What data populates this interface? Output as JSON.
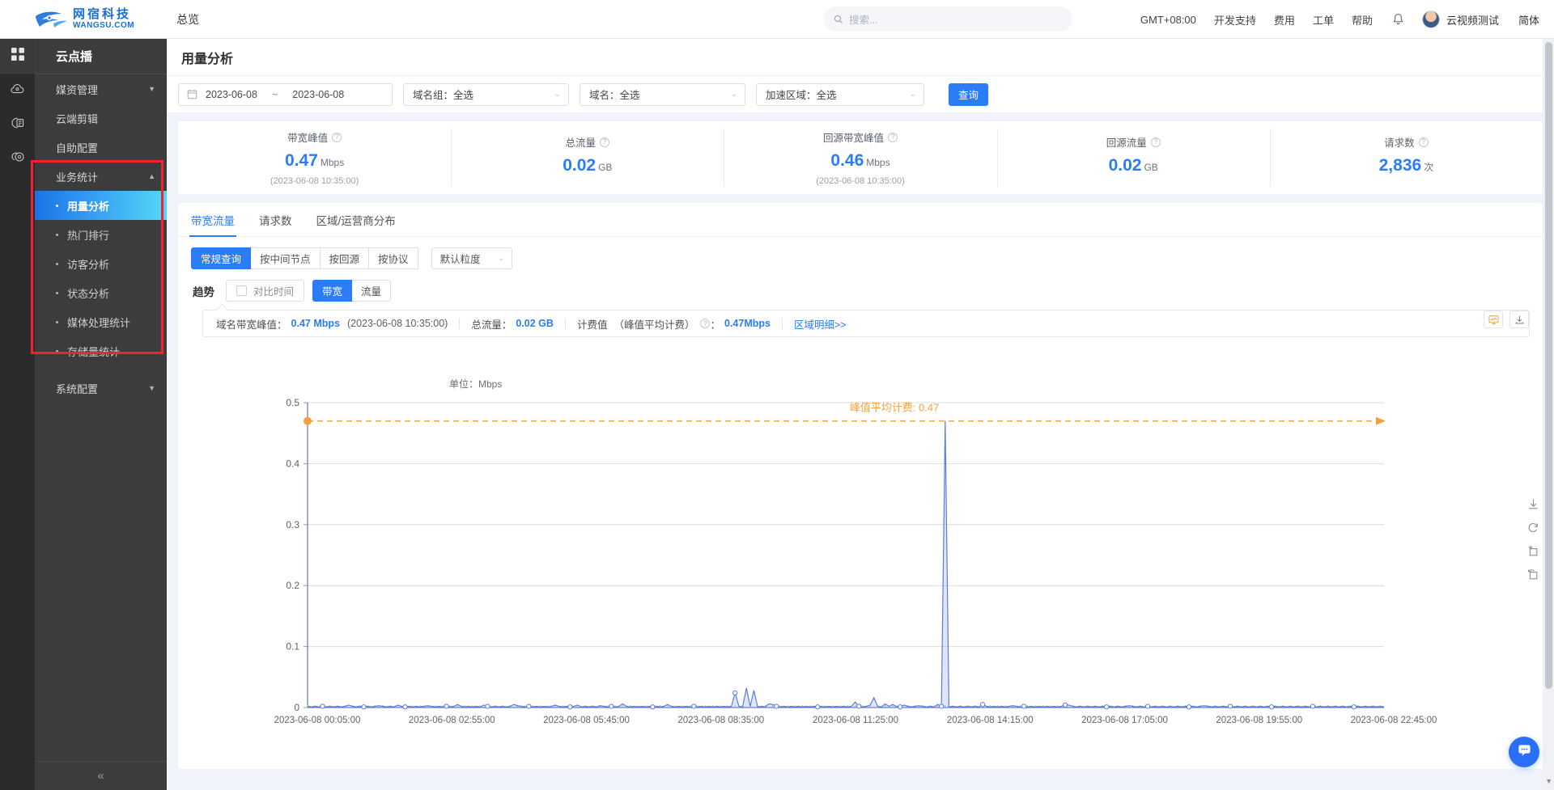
{
  "header": {
    "logo_cn": "网宿科技",
    "logo_en": "WANGSU.COM",
    "nav_overview": "总览",
    "search_placeholder": "搜索...",
    "timezone": "GMT+08:00",
    "links": [
      "开发支持",
      "费用",
      "工单",
      "帮助"
    ],
    "username": "云视频测试",
    "language": "简体"
  },
  "rail": {
    "items": [
      "apps-icon",
      "cloud-icon",
      "media-icon",
      "live-icon"
    ]
  },
  "sidebar": {
    "title": "云点播",
    "groups": [
      {
        "label": "媒资管理",
        "caret": "▼"
      },
      {
        "label": "云端剪辑",
        "caret": ""
      },
      {
        "label": "自助配置",
        "caret": ""
      }
    ],
    "stats_group": {
      "label": "业务统计",
      "caret": "▲"
    },
    "stats_items": [
      {
        "label": "用量分析",
        "active": true
      },
      {
        "label": "热门排行",
        "active": false
      },
      {
        "label": "访客分析",
        "active": false
      },
      {
        "label": "状态分析",
        "active": false
      },
      {
        "label": "媒体处理统计",
        "active": false
      },
      {
        "label": "存储量统计",
        "active": false
      }
    ],
    "system_group": {
      "label": "系统配置",
      "caret": "▼"
    },
    "collapse": "«"
  },
  "page": {
    "title": "用量分析"
  },
  "filters": {
    "date_start": "2023-06-08",
    "date_sep": "~",
    "date_end": "2023-06-08",
    "domain_group": "域名组：全选",
    "domain": "域名：全选",
    "region": "加速区域：全选",
    "query_button": "查询"
  },
  "stats": [
    {
      "label": "带宽峰值",
      "value": "0.47",
      "unit": "Mbps",
      "time": "(2023-06-08 10:35:00)"
    },
    {
      "label": "总流量",
      "value": "0.02",
      "unit": "GB",
      "time": ""
    },
    {
      "label": "回源带宽峰值",
      "value": "0.46",
      "unit": "Mbps",
      "time": "(2023-06-08 10:35:00)"
    },
    {
      "label": "回源流量",
      "value": "0.02",
      "unit": "GB",
      "time": ""
    },
    {
      "label": "请求数",
      "value": "2,836",
      "unit": "次",
      "time": ""
    }
  ],
  "tabs": [
    {
      "label": "带宽流量",
      "active": true
    },
    {
      "label": "请求数",
      "active": false
    },
    {
      "label": "区域/运营商分布",
      "active": false
    }
  ],
  "segments": [
    {
      "label": "常规查询",
      "active": true
    },
    {
      "label": "按中间节点",
      "active": false
    },
    {
      "label": "按回源",
      "active": false
    },
    {
      "label": "按协议",
      "active": false
    }
  ],
  "granularity": "默认粒度",
  "trend": {
    "label": "趋势",
    "compare_label": "对比时间",
    "metrics": [
      {
        "label": "带宽",
        "active": true
      },
      {
        "label": "流量",
        "active": false
      }
    ]
  },
  "info_bar": {
    "peak_label": "域名带宽峰值：",
    "peak_value": "0.47 Mbps",
    "peak_time": "(2023-06-08 10:35:00)",
    "total_label": "总流量：",
    "total_value": "0.02 GB",
    "billing_label": "计费值",
    "billing_mode": "（峰值平均计费）",
    "billing_colon": "：",
    "billing_value": "0.47Mbps",
    "region_link": "区域明细>>"
  },
  "chart_tools": {
    "chart_icon": "chart-toggle-icon",
    "download_icon": "download-icon"
  },
  "side_tools": [
    "download-icon",
    "refresh-icon",
    "zoom-icon",
    "restore-icon"
  ],
  "chart_data": {
    "type": "line",
    "title": "",
    "unit_label": "单位：Mbps",
    "xlabel": "",
    "ylabel": "Mbps",
    "ylim": [
      0,
      0.5
    ],
    "yticks": [
      "0",
      "0.1",
      "0.2",
      "0.3",
      "0.4",
      "0.5"
    ],
    "ytick_values": [
      0,
      0.1,
      0.2,
      0.3,
      0.4,
      0.5
    ],
    "grid": true,
    "legend_position": "none",
    "xticks": [
      "2023-06-08 00:05:00",
      "2023-06-08 02:55:00",
      "2023-06-08 05:45:00",
      "2023-06-08 08:35:00",
      "2023-06-08 11:25:00",
      "2023-06-08 14:15:00",
      "2023-06-08 17:05:00",
      "2023-06-08 19:55:00",
      "2023-06-08 22:45:00"
    ],
    "annotation": {
      "text": "峰值平均计费: 0.47",
      "value": 0.47,
      "color": "#f0a23c",
      "style": "dashed-horizontal-with-arrow"
    },
    "series": [
      {
        "name": "带宽",
        "color": "#6b8ff0",
        "area": true,
        "values": [
          0.002,
          0.001,
          0.002,
          0.001,
          0.002,
          0.001,
          0.002,
          0.001,
          0.002,
          0.001,
          0.002,
          0.004,
          0.002,
          0.001,
          0.002,
          0.001,
          0.002,
          0.001,
          0.002,
          0.003,
          0.002,
          0.001,
          0.002,
          0.001,
          0.004,
          0.002,
          0.001,
          0.002,
          0.001,
          0.002,
          0.001,
          0.002,
          0.003,
          0.002,
          0.001,
          0.002,
          0.001,
          0.002,
          0.001,
          0.002,
          0.005,
          0.002,
          0.001,
          0.002,
          0.001,
          0.002,
          0.001,
          0.004,
          0.002,
          0.001,
          0.002,
          0.001,
          0.002,
          0.001,
          0.002,
          0.005,
          0.003,
          0.002,
          0.001,
          0.002,
          0.001,
          0.002,
          0.001,
          0.002,
          0.001,
          0.002,
          0.004,
          0.002,
          0.001,
          0.002,
          0.001,
          0.002,
          0.004,
          0.001,
          0.002,
          0.001,
          0.002,
          0.001,
          0.003,
          0.002,
          0.001,
          0.002,
          0.001,
          0.002,
          0.006,
          0.002,
          0.001,
          0.002,
          0.001,
          0.002,
          0.001,
          0.002,
          0.001,
          0.002,
          0.001,
          0.002,
          0.005,
          0.002,
          0.001,
          0.002,
          0.001,
          0.002,
          0.001,
          0.002,
          0.001,
          0.002,
          0.001,
          0.002,
          0.001,
          0.002,
          0.001,
          0.002,
          0.001,
          0.002,
          0.024,
          0.002,
          0.001,
          0.032,
          0.002,
          0.028,
          0.001,
          0.002,
          0.001,
          0.006,
          0.005,
          0.002,
          0.001,
          0.002,
          0.001,
          0.002,
          0.001,
          0.002,
          0.001,
          0.002,
          0.001,
          0.002,
          0.001,
          0.002,
          0.001,
          0.002,
          0.001,
          0.002,
          0.001,
          0.002,
          0.001,
          0.002,
          0.009,
          0.002,
          0.001,
          0.002,
          0.004,
          0.016,
          0.002,
          0.001,
          0.006,
          0.002,
          0.005,
          0.002,
          0.001,
          0.004,
          0.002,
          0.001,
          0.002,
          0.003,
          0.002,
          0.001,
          0.002,
          0.001,
          0.005,
          0.002,
          0.47,
          0.001,
          0.002,
          0.001,
          0.002,
          0.001,
          0.002,
          0.001,
          0.002,
          0.001,
          0.005,
          0.002,
          0.001,
          0.002,
          0.001,
          0.002,
          0.001,
          0.002,
          0.003,
          0.002,
          0.001,
          0.002,
          0.001,
          0.002,
          0.001,
          0.002,
          0.001,
          0.002,
          0.001,
          0.002,
          0.001,
          0.002,
          0.004,
          0.004,
          0.002,
          0.001,
          0.002,
          0.001,
          0.002,
          0.001,
          0.002,
          0.001,
          0.002,
          0.001,
          0.002,
          0.001,
          0.002,
          0.001,
          0.002,
          0.003,
          0.002,
          0.001,
          0.002,
          0.001,
          0.002,
          0.001,
          0.002,
          0.001,
          0.002,
          0.001,
          0.002,
          0.001,
          0.002,
          0.001,
          0.002,
          0.001,
          0.002,
          0.001,
          0.002,
          0.003,
          0.002,
          0.001,
          0.002,
          0.001,
          0.002,
          0.001,
          0.002,
          0.001,
          0.002,
          0.001,
          0.002,
          0.001,
          0.002,
          0.001,
          0.002,
          0.001,
          0.002,
          0.001,
          0.002,
          0.001,
          0.002,
          0.001,
          0.002,
          0.001,
          0.002,
          0.001,
          0.002,
          0.001,
          0.002,
          0.001,
          0.002,
          0.001,
          0.002,
          0.001,
          0.002,
          0.001,
          0.002,
          0.001,
          0.002,
          0.001,
          0.002,
          0.001,
          0.002,
          0.001,
          0.002,
          0.001,
          0.002,
          0.001
        ]
      }
    ]
  }
}
